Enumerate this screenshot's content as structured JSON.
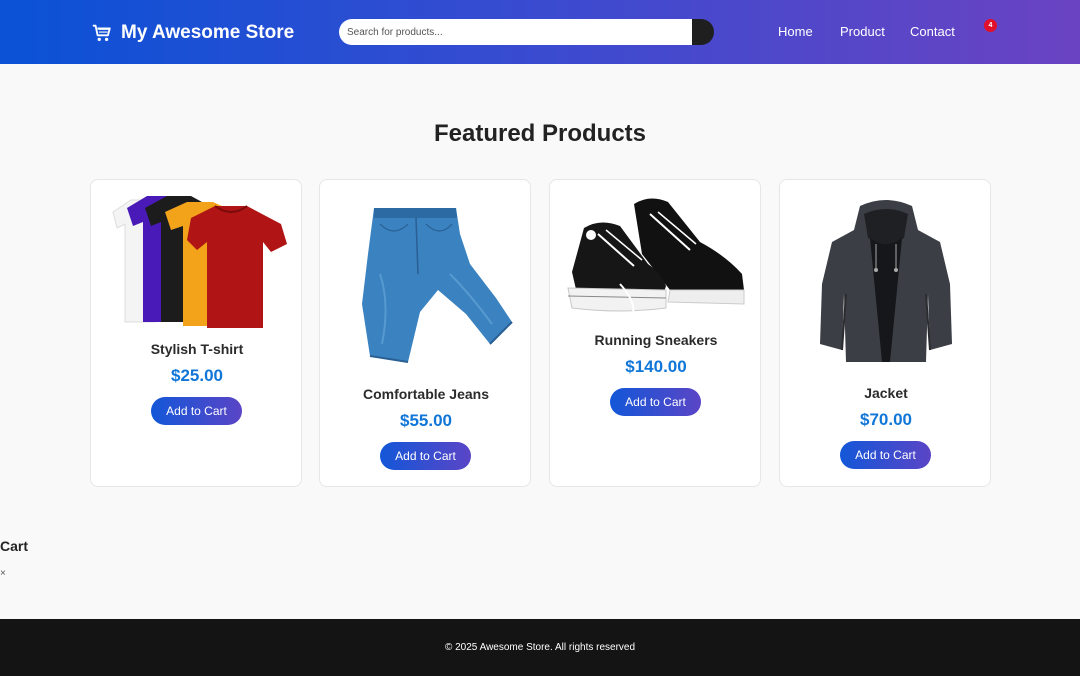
{
  "header": {
    "brand": "My Awesome Store",
    "search_placeholder": "Search for products...",
    "nav": [
      "Home",
      "Product",
      "Contact"
    ],
    "cart_count": "4"
  },
  "main": {
    "title": "Featured Products",
    "products": [
      {
        "name": "Stylish T-shirt",
        "price": "$25.00",
        "button": "Add to Cart"
      },
      {
        "name": "Comfortable Jeans",
        "price": "$55.00",
        "button": "Add to Cart"
      },
      {
        "name": "Running Sneakers",
        "price": "$140.00",
        "button": "Add to Cart"
      },
      {
        "name": "Jacket",
        "price": "$70.00",
        "button": "Add to Cart"
      }
    ]
  },
  "cart": {
    "title": "Cart",
    "close": "×"
  },
  "footer": {
    "text": "© 2025 Awesome Store. All rights reserved"
  },
  "colors": {
    "header_start": "#0a52d6",
    "header_end": "#6a43c2",
    "price": "#1076d8",
    "badge": "#e0102a",
    "footer": "#141414"
  },
  "icons": [
    "shopping-cart-icon",
    "search-icon"
  ]
}
